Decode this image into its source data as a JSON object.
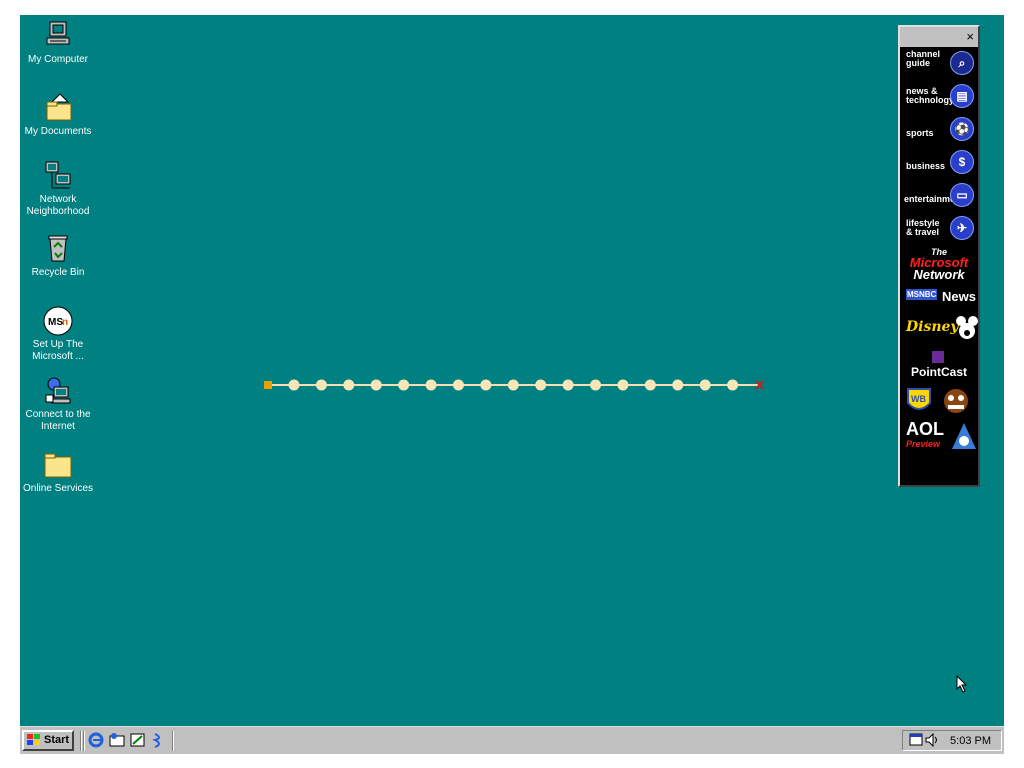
{
  "desktop": {
    "icons": [
      {
        "label": "My Computer"
      },
      {
        "label": "My Documents"
      },
      {
        "label": "Network Neighborhood"
      },
      {
        "label": "Recycle Bin"
      },
      {
        "label": "Set Up The Microsoft ..."
      },
      {
        "label": "Connect to the Internet"
      },
      {
        "label": "Online Services"
      }
    ]
  },
  "channel_bar": {
    "close_label": "×",
    "channels": [
      {
        "label": "channel guide"
      },
      {
        "label": "news & technology"
      },
      {
        "label": "sports"
      },
      {
        "label": "business"
      },
      {
        "label": "entertainment"
      },
      {
        "label": "lifestyle & travel"
      }
    ],
    "brands": {
      "msn_the": "The",
      "msn_microsoft": "Microsoft",
      "msn_network": "Network",
      "msnbc": "News",
      "msnbc_logo": "MSNBC",
      "disney": "Disney",
      "pointcast": "PointCast",
      "warner": "WB",
      "aol": "AOL",
      "aol_preview": "Preview"
    }
  },
  "progress": {
    "completed_dots": 17,
    "total_dots": 17
  },
  "taskbar": {
    "start_label": "Start",
    "clock": "5:03 PM"
  }
}
